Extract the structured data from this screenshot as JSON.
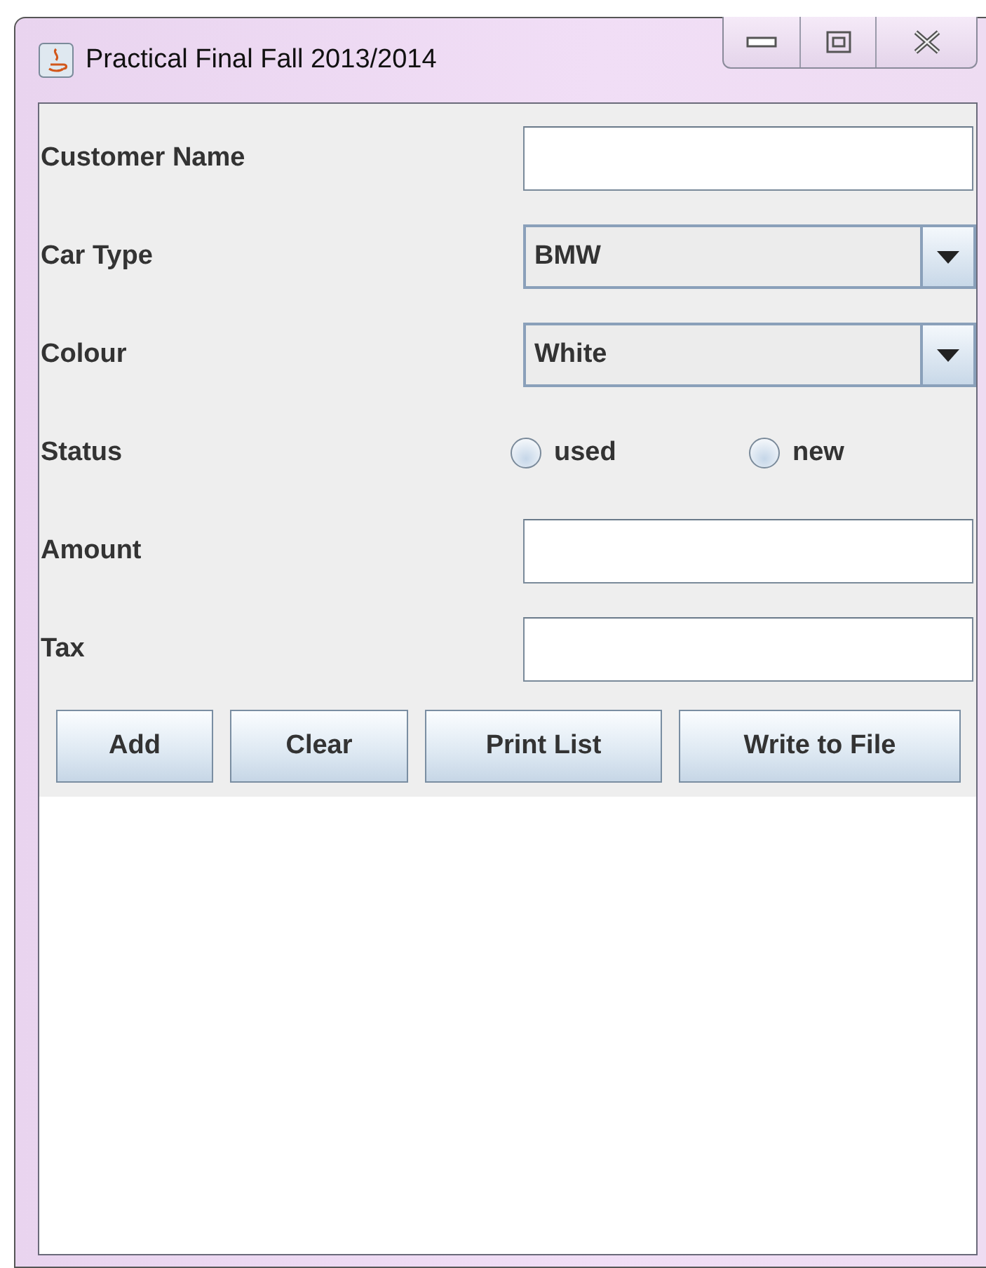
{
  "window": {
    "title": "Practical Final Fall 2013/2014"
  },
  "fields": [
    {
      "kind": "text",
      "label": "Customer Name"
    },
    {
      "kind": "combo",
      "label": "Car Type",
      "value": "BMW"
    },
    {
      "kind": "combo",
      "label": "Colour",
      "value": "White"
    },
    {
      "kind": "radio",
      "label": "Status",
      "options": [
        {
          "label": "used",
          "selected": false
        },
        {
          "label": "new",
          "selected": false
        }
      ]
    },
    {
      "kind": "text",
      "label": "Amount"
    },
    {
      "kind": "text",
      "label": "Tax"
    }
  ],
  "buttons": [
    "Add",
    "Clear",
    "Print List",
    "Write to File"
  ]
}
